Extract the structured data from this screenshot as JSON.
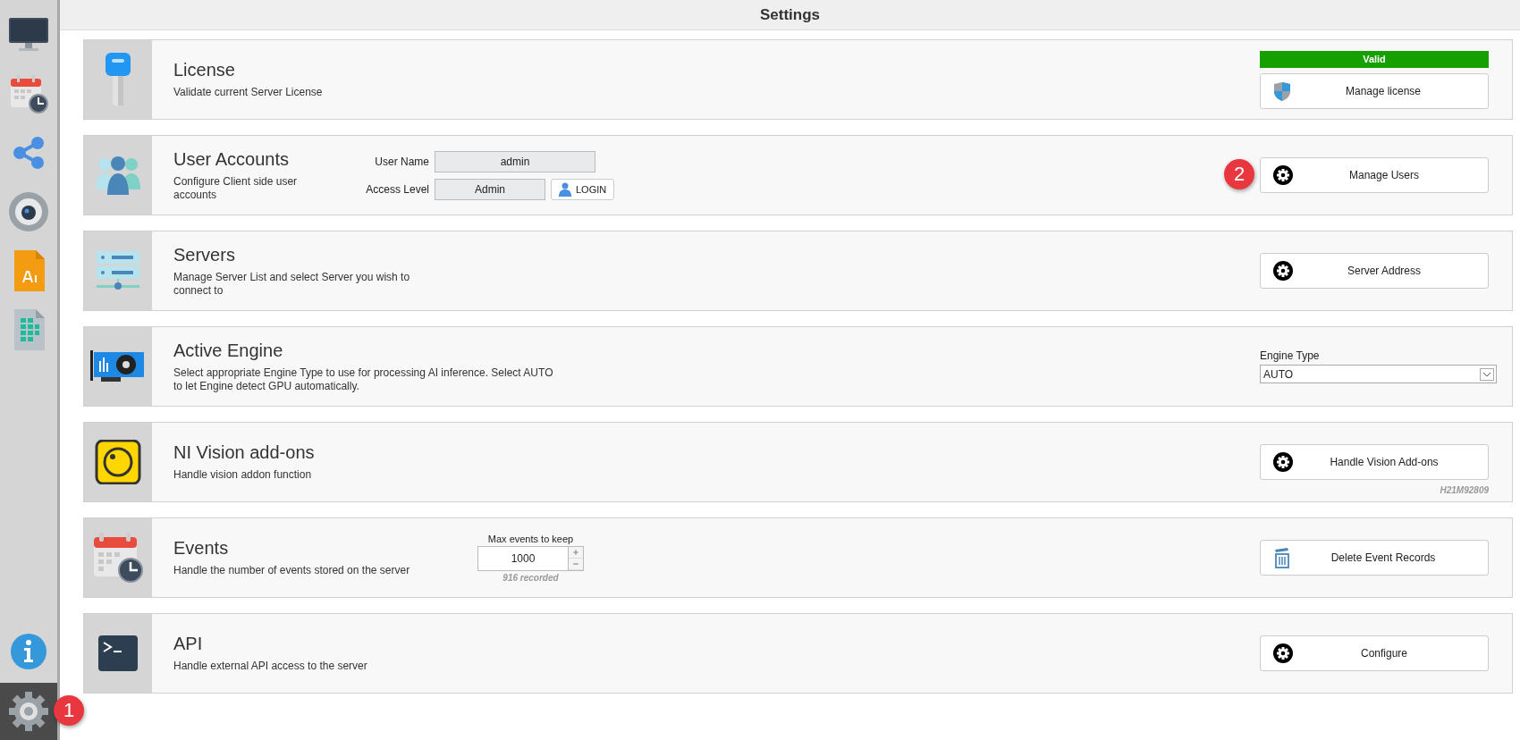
{
  "window": {
    "title": "Settings"
  },
  "sidebar": {
    "items": [
      {
        "kind": "monitor",
        "selected": false
      },
      {
        "kind": "calendar",
        "selected": false
      },
      {
        "kind": "share",
        "selected": false
      },
      {
        "kind": "webcam",
        "selected": false
      },
      {
        "kind": "ai-file",
        "selected": false
      },
      {
        "kind": "sheet",
        "selected": false
      }
    ],
    "bottom_items": [
      {
        "kind": "info",
        "selected": false
      },
      {
        "kind": "settings",
        "selected": true,
        "badge": "1"
      }
    ]
  },
  "sections": [
    {
      "kind": "license",
      "title": "License",
      "description": "Validate current Server License",
      "status": "Valid",
      "button": {
        "label": "Manage license"
      }
    },
    {
      "kind": "accounts",
      "title": "User Accounts",
      "description": "Configure Client side user accounts",
      "fields": [
        {
          "label": "User Name",
          "value": "admin"
        },
        {
          "label": "Access Level",
          "value": "Admin"
        }
      ],
      "login_button": "LOGIN",
      "button": {
        "label": "Manage Users",
        "badge": "2"
      }
    },
    {
      "kind": "servers",
      "title": "Servers",
      "description": "Manage Server List and select Server you wish to connect to",
      "button": {
        "label": "Server Address"
      }
    },
    {
      "kind": "engine",
      "title": "Active Engine",
      "description": "Select appropriate Engine Type to use for processing AI inference. Select AUTO to let Engine detect GPU automatically.",
      "dropdown": {
        "label": "Engine Type",
        "value": "AUTO"
      }
    },
    {
      "kind": "vision",
      "title": "NI Vision add-ons",
      "description": "Handle vision addon function",
      "button": {
        "label": "Handle Vision Add-ons"
      },
      "footnote": "H21M92809"
    },
    {
      "kind": "events",
      "title": "Events",
      "description": "Handle the number of events stored on the server",
      "spinner": {
        "label": "Max events to keep",
        "value": "1000",
        "note": "916 recorded"
      },
      "button": {
        "label": "Delete Event Records"
      }
    },
    {
      "kind": "api",
      "title": "API",
      "description": "Handle external API access to the server",
      "button": {
        "label": "Configure"
      }
    }
  ]
}
